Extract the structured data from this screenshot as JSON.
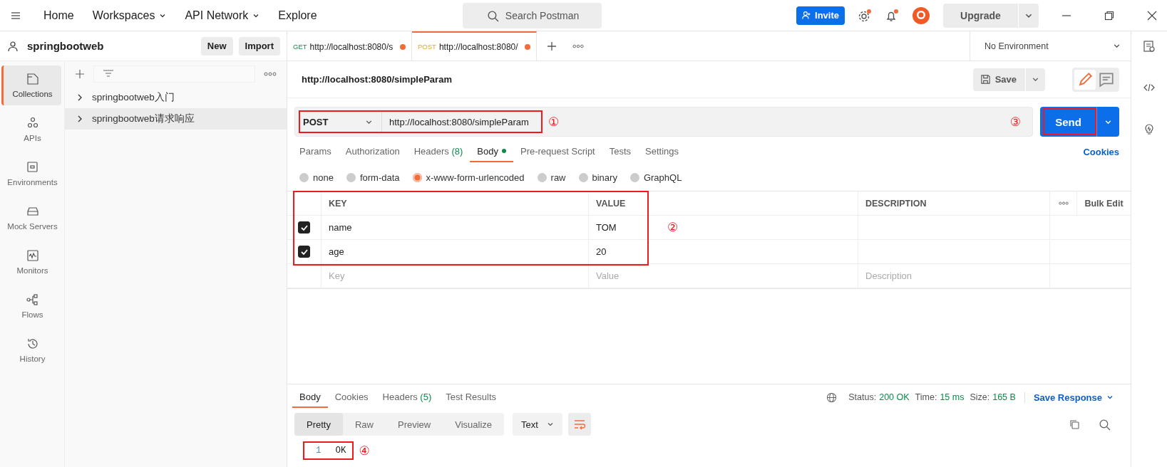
{
  "top_bar": {
    "nav": [
      {
        "label": "Home",
        "dropdown": false
      },
      {
        "label": "Workspaces",
        "dropdown": true
      },
      {
        "label": "API Network",
        "dropdown": true
      },
      {
        "label": "Explore",
        "dropdown": false
      }
    ],
    "search": {
      "placeholder": "Search Postman"
    },
    "invite": "Invite",
    "upgrade": "Upgrade"
  },
  "workspace": {
    "name": "springbootweb",
    "buttons": [
      "New",
      "Import"
    ]
  },
  "rail": [
    {
      "label": "Collections",
      "kind": "collections",
      "selected": true
    },
    {
      "label": "APIs",
      "kind": "apis",
      "selected": false
    },
    {
      "label": "Environments",
      "kind": "environments",
      "selected": false
    },
    {
      "label": "Mock Servers",
      "kind": "mock",
      "selected": false
    },
    {
      "label": "Monitors",
      "kind": "monitors",
      "selected": false
    },
    {
      "label": "Flows",
      "kind": "flows",
      "selected": false
    },
    {
      "label": "History",
      "kind": "history",
      "selected": false
    }
  ],
  "collections": [
    {
      "name": "springbootweb入门",
      "selected": false
    },
    {
      "name": "springbootweb请求响应",
      "selected": true
    }
  ],
  "tabs": [
    {
      "method": "GET",
      "kind": "get",
      "url": "http://localhost:8080/s",
      "selected": false
    },
    {
      "method": "POST",
      "kind": "post",
      "url": "http://localhost:8080/",
      "selected": true
    }
  ],
  "environment": "No Environment",
  "request": {
    "title": "http://localhost:8080/simpleParam",
    "save": "Save",
    "method": "POST",
    "url": "http://localhost:8080/simpleParam",
    "url_marker": "①",
    "send": "Send",
    "send_marker": "③"
  },
  "request_tabs": [
    {
      "label": "Params",
      "dot": false,
      "selected": false
    },
    {
      "label": "Authorization",
      "dot": false,
      "selected": false
    },
    {
      "label": "Headers",
      "count": "(8)",
      "dot": false,
      "selected": false
    },
    {
      "label": "Body",
      "dot": true,
      "selected": true
    },
    {
      "label": "Pre-request Script",
      "dot": false,
      "selected": false
    },
    {
      "label": "Tests",
      "dot": false,
      "selected": false
    },
    {
      "label": "Settings",
      "dot": false,
      "selected": false
    }
  ],
  "cookies": "Cookies",
  "body_types": [
    {
      "label": "none",
      "selected": false
    },
    {
      "label": "form-data",
      "selected": false
    },
    {
      "label": "x-www-form-urlencoded",
      "selected": true
    },
    {
      "label": "raw",
      "selected": false
    },
    {
      "label": "binary",
      "selected": false
    },
    {
      "label": "GraphQL",
      "selected": false
    }
  ],
  "params": {
    "columns": [
      "KEY",
      "VALUE",
      "DESCRIPTION"
    ],
    "bulk_edit": "Bulk Edit",
    "marker": "②",
    "rows": [
      {
        "checked": true,
        "key": "name",
        "value": "TOM"
      },
      {
        "checked": true,
        "key": "age",
        "value": "20"
      }
    ],
    "new_row": {
      "key": {
        "placeholder": "Key"
      },
      "value": {
        "placeholder": "Value"
      },
      "description": {
        "placeholder": "Description"
      }
    }
  },
  "response": {
    "tabs": [
      {
        "label": "Body",
        "selected": true
      },
      {
        "label": "Cookies",
        "selected": false
      },
      {
        "label": "Headers",
        "count": "(5)",
        "selected": false
      },
      {
        "label": "Test Results",
        "selected": false
      }
    ],
    "meta": [
      {
        "label": "Status:",
        "value": "200 OK"
      },
      {
        "label": "Time:",
        "value": "15 ms"
      },
      {
        "label": "Size:",
        "value": "165 B"
      }
    ],
    "save_response": "Save Response",
    "views": [
      {
        "label": "Pretty",
        "selected": true
      },
      {
        "label": "Raw",
        "selected": false
      },
      {
        "label": "Preview",
        "selected": false
      },
      {
        "label": "Visualize",
        "selected": false
      }
    ],
    "format": "Text",
    "marker": "④",
    "lines": [
      {
        "number": "1",
        "text": "OK"
      }
    ]
  }
}
